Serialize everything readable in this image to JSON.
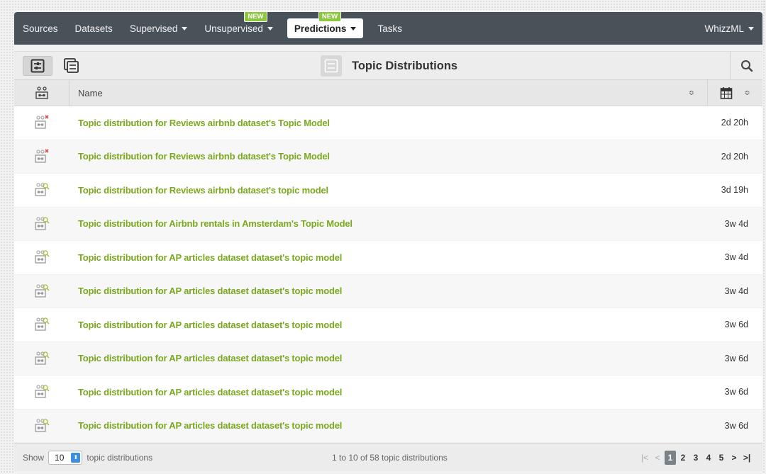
{
  "nav": {
    "items": [
      {
        "label": "Sources",
        "caret": false
      },
      {
        "label": "Datasets",
        "caret": false
      },
      {
        "label": "Supervised",
        "caret": true
      },
      {
        "label": "Unsupervised",
        "caret": true,
        "badge": "NEW"
      },
      {
        "label": "Predictions",
        "caret": true,
        "badge": "NEW",
        "active": true
      },
      {
        "label": "Tasks",
        "caret": false
      }
    ],
    "right": {
      "label": "WhizzML"
    }
  },
  "toolbar": {
    "title": "Topic Distributions",
    "view_buttons": [
      "single-view-icon",
      "batch-view-icon"
    ],
    "search_icon": "search-icon"
  },
  "table": {
    "header": {
      "name": "Name",
      "type_icon": "model-icon",
      "date_icon": "calendar-icon",
      "sort_glyph": "≎"
    },
    "rows": [
      {
        "name": "Topic distribution for Reviews airbnb dataset's Topic Model",
        "age": "2d 20h",
        "status": "error"
      },
      {
        "name": "Topic distribution for Reviews airbnb dataset's Topic Model",
        "age": "2d 20h",
        "status": "error"
      },
      {
        "name": "Topic distribution for Reviews airbnb dataset's topic model",
        "age": "3d 19h",
        "status": "ok"
      },
      {
        "name": "Topic distribution for Airbnb rentals in Amsterdam's Topic Model",
        "age": "3w 4d",
        "status": "ok"
      },
      {
        "name": "Topic distribution for AP articles dataset dataset's topic model",
        "age": "3w 4d",
        "status": "ok"
      },
      {
        "name": "Topic distribution for AP articles dataset dataset's topic model",
        "age": "3w 4d",
        "status": "ok"
      },
      {
        "name": "Topic distribution for AP articles dataset dataset's topic model",
        "age": "3w 6d",
        "status": "ok"
      },
      {
        "name": "Topic distribution for AP articles dataset dataset's topic model",
        "age": "3w 6d",
        "status": "ok"
      },
      {
        "name": "Topic distribution for AP articles dataset dataset's topic model",
        "age": "3w 6d",
        "status": "ok"
      },
      {
        "name": "Topic distribution for AP articles dataset dataset's topic model",
        "age": "3w 6d",
        "status": "ok"
      }
    ]
  },
  "footer": {
    "show_label": "Show",
    "page_size": "10",
    "per_label": "topic distributions",
    "range": "1 to 10 of 58 topic distributions",
    "pages": [
      "1",
      "2",
      "3",
      "4",
      "5"
    ],
    "current_page": "1",
    "first": "|<",
    "prev": "<",
    "next": ">",
    "last": ">|"
  },
  "colors": {
    "nav_bg": "#4a5259",
    "link_green": "#7aa81f",
    "badge_green": "#8dc63f",
    "error_red": "#d9534f",
    "spinner_blue": "#3b8fe0"
  }
}
